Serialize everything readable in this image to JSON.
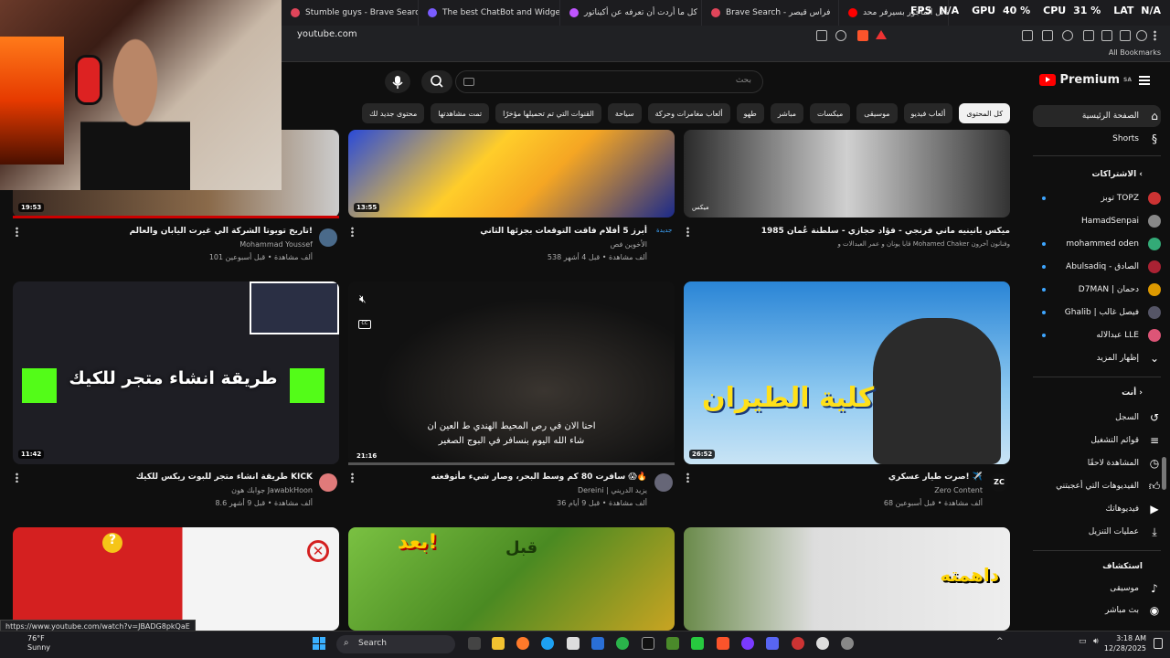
{
  "browser": {
    "tabs": [
      {
        "label": "Stumble guys - Brave Search"
      },
      {
        "label": "The best ChatBot and Widgets for K"
      },
      {
        "label": "كل ما أردت أن تعرفه عن أكيناتور"
      },
      {
        "label": "Brave Search - فراس قيصر"
      },
      {
        "label": "رئيس الحرب والقائل الماجور بسيرفر محد..."
      }
    ],
    "url": "youtube.com",
    "bookmarks_label": "All Bookmarks",
    "status_url": "https://www.youtube.com/watch?v=JBADG8pkQaE"
  },
  "overlay_stats": {
    "fps_label": "FPS",
    "fps_value": "N/A",
    "gpu_label": "GPU",
    "gpu_value": "40 %",
    "cpu_label": "CPU",
    "cpu_value": "31 %",
    "lat_label": "LAT",
    "lat_value": "N/A"
  },
  "youtube": {
    "logo_text": "Premium",
    "logo_region": "SA",
    "search_placeholder": "بحث",
    "chips": [
      "كل المحتوى",
      "ألعاب فيديو",
      "موسيقى",
      "ميكسات",
      "مباشر",
      "طهو",
      "ألعاب مغامرات وحركة",
      "سياحة",
      "القنوات التي تم تحميلها مؤخرًا",
      "تمت مشاهدتها",
      "محتوى جديد لك"
    ],
    "sidebar": {
      "home": "الصفحة الرئيسية",
      "shorts": "Shorts",
      "subscriptions_header": "الاشتراكات",
      "subscriptions": [
        "توبز TOPZ",
        "HamadSenpai",
        "mohammed oden",
        "Abulsadiq - الصادق",
        "D7MAN | دحمان",
        "Ghalib | فيصل غالب",
        "عبدالاله LLE"
      ],
      "show_more": "إظهار المزيد",
      "you_header": "أنت",
      "you_items": [
        "السجل",
        "قوائم التشغيل",
        "المشاهدة لاحقًا",
        "الفيديوهات التي أعجبتني",
        "فيديوهاتك",
        "عمليات التنزيل"
      ],
      "explore_header": "استكشاف",
      "explore_items": [
        "موسيقى",
        "بث مباشر"
      ]
    },
    "videos": [
      {
        "title": "تاريخ تويوتا الشركة الي غيرت اليابان والعالم!",
        "channel": "Mohammad Youssef",
        "meta": "101 ألف مشاهدة • قبل أسبوعين",
        "duration": "19:53"
      },
      {
        "title": "أبرز 5 أفلام فاقت التوقعات بجزئها الثاني",
        "channel": "الأخوين فص",
        "meta": "538 ألف مشاهدة • قبل 4 أشهر",
        "duration": "13:55",
        "badge": "جديدة"
      },
      {
        "title": "ميكس بانينيه ماني فرنجي - فؤاد حجازي - سلطنة عُمان 1985",
        "channel": "قابا يونان و عمر العبدالات و Mohamed Chaker وفنانون آخرون",
        "meta": "",
        "duration": "",
        "thumb_caption": "ميكس"
      },
      {
        "title": "طريقة انشاء متجر للبوت ريكس للكيك KICK",
        "channel": "جوابك هون JawabkHoon",
        "meta": "8.6 ألف مشاهدة • قبل 9 أشهر",
        "duration": "11:42",
        "thumb_text": "طريقة انشاء متجر للكيك"
      },
      {
        "title": "سافرت 80 كم وسط البحر، وصار شيء مأتوقعته 😱🔥",
        "channel": "Dereini | يزيد الدريني",
        "meta": "36 ألف مشاهدة • قبل 9 أيام",
        "duration": "21:16",
        "subtitle_line1": "احنا الان في رص المحيط الهندي ط العين ان",
        "subtitle_line2": "شاء الله اليوم بنسافر في البوج الصغير"
      },
      {
        "title": "صرت طيار عسكري! ✈️",
        "channel": "Zero Content",
        "meta": "68 ألف مشاهدة • قبل أسبوعين",
        "duration": "26:52",
        "thumb_text": "كلية الطيران",
        "avatar_text": "ZC"
      },
      {
        "thumb_text": "بعد!",
        "thumb_text2": "قبل"
      },
      {
        "thumb_text": "داهمته"
      }
    ]
  },
  "taskbar": {
    "weather_temp": "76°F",
    "weather_desc": "Sunny",
    "search_label": "Search",
    "time": "3:18 AM",
    "date": "12/28/2025"
  }
}
